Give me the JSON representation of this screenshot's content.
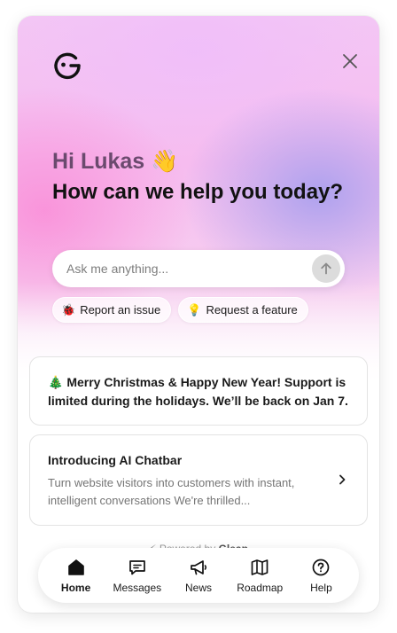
{
  "header": {
    "logo_icon": "smile-logo-icon",
    "close_icon": "close-icon"
  },
  "hero": {
    "greeting": "Hi Lukas 👋",
    "headline": "How can we help you today?"
  },
  "search": {
    "placeholder": "Ask me anything...",
    "value": "",
    "send_icon": "arrow-up-icon"
  },
  "quick_actions": [
    {
      "label": "Report an issue",
      "icon": "🐞"
    },
    {
      "label": "Request a feature",
      "icon": "💡"
    }
  ],
  "announcement": {
    "text": "🎄 Merry Christmas & Happy New Year! Support is limited during the holidays. We’ll be back on Jan 7."
  },
  "news_card": {
    "title": "Introducing AI Chatbar",
    "description": "Turn website visitors into customers with instant, intelligent conversations We're thrilled..."
  },
  "powered_by": {
    "prefix": "⚡ Powered by",
    "brand": "Gleap"
  },
  "nav": [
    {
      "label": "Home",
      "icon": "home-icon",
      "active": true
    },
    {
      "label": "Messages",
      "icon": "chat-icon",
      "active": false
    },
    {
      "label": "News",
      "icon": "megaphone-icon",
      "active": false
    },
    {
      "label": "Roadmap",
      "icon": "map-icon",
      "active": false
    },
    {
      "label": "Help",
      "icon": "help-icon",
      "active": false
    }
  ],
  "colors": {
    "accent_text": "#6b4a6e",
    "gradient_pink": "#f6bcef",
    "gradient_lavender": "#aaa0ee"
  }
}
